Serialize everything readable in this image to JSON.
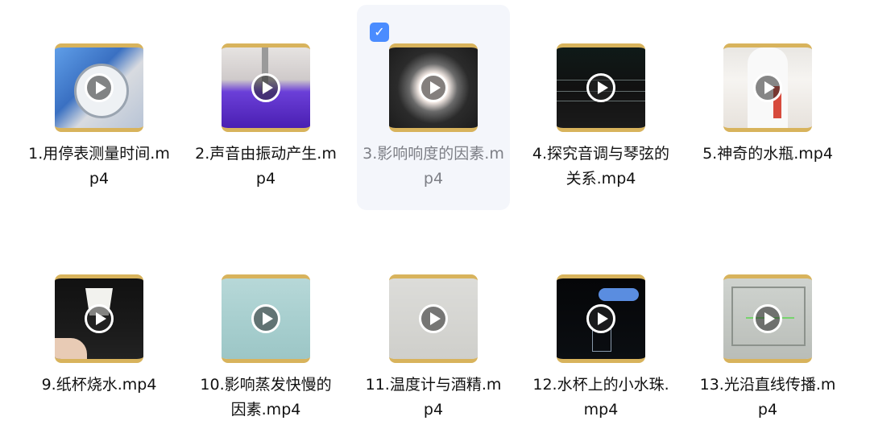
{
  "files": [
    {
      "name": "1.用停表测量时间.mp4",
      "icon": "play-icon",
      "selected": false
    },
    {
      "name": "2.声音由振动产生.mp4",
      "icon": "play-icon",
      "selected": false
    },
    {
      "name": "3.影响响度的因素.mp4",
      "icon": "play-icon",
      "selected": true
    },
    {
      "name": "4.探究音调与琴弦的关系.mp4",
      "icon": "play-icon",
      "selected": false
    },
    {
      "name": "5.神奇的水瓶.mp4",
      "icon": "play-icon",
      "selected": false
    },
    {
      "name": "9.纸杯烧水.mp4",
      "icon": "play-icon",
      "selected": false
    },
    {
      "name": "10.影响蒸发快慢的因素.mp4",
      "icon": "play-icon",
      "selected": false
    },
    {
      "name": "11.温度计与酒精.mp4",
      "icon": "play-icon",
      "selected": false
    },
    {
      "name": "12.水杯上的小水珠.mp4",
      "icon": "play-icon",
      "selected": false
    },
    {
      "name": "13.光沿直线传播.mp4",
      "icon": "play-icon",
      "selected": false
    }
  ],
  "colors": {
    "checkbox": "#4a8cff",
    "selected_bg": "#f4f6fb",
    "thumb_border": "#d8b35c",
    "selected_text": "#7d7f86"
  }
}
